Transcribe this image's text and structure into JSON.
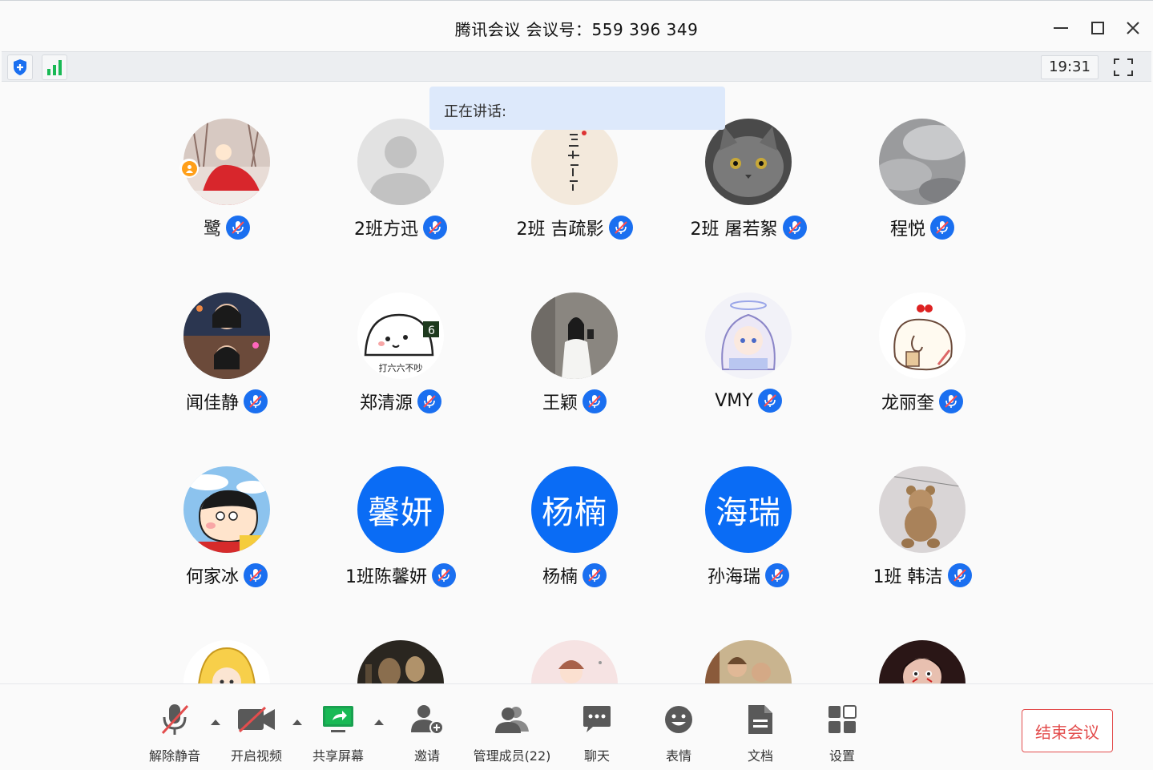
{
  "window": {
    "title": "腾讯会议 会议号：559 396 349"
  },
  "infobar": {
    "clock": "19:31",
    "icons": [
      "shield-icon",
      "signal-icon",
      "fullscreen-icon"
    ]
  },
  "speaking": {
    "label": "正在讲话:"
  },
  "participants": [
    {
      "name": "鹭",
      "avatar": "photo-girl-red-dress",
      "host": true
    },
    {
      "name": "2班方迅",
      "avatar": "default-silhouette"
    },
    {
      "name": "2班 吉疏影",
      "avatar": "photo-calligraphy"
    },
    {
      "name": "2班 屠若絮",
      "avatar": "photo-gray-cat"
    },
    {
      "name": "程悦",
      "avatar": "photo-cloudy-sky"
    },
    {
      "name": "闻佳静",
      "avatar": "photo-girl-portrait"
    },
    {
      "name": "郑清源",
      "avatar": "cartoon-face",
      "avatar_caption": "打六六不吵"
    },
    {
      "name": "王颖",
      "avatar": "photo-mirror-selfie"
    },
    {
      "name": "VMY",
      "avatar": "anime-character"
    },
    {
      "name": "龙丽奎",
      "avatar": "cartoon-bubble-tea"
    },
    {
      "name": "何家冰",
      "avatar": "cartoon-shin-chan"
    },
    {
      "name": "1班陈馨妍",
      "avatar": "text",
      "avatar_text": "馨妍"
    },
    {
      "name": "杨楠",
      "avatar": "text",
      "avatar_text": "杨楠"
    },
    {
      "name": "孙海瑞",
      "avatar": "text",
      "avatar_text": "海瑞"
    },
    {
      "name": "1班 韩洁",
      "avatar": "photo-teddy-bear"
    },
    {
      "name": "",
      "avatar": "cartoon-yellow-hood"
    },
    {
      "name": "",
      "avatar": "photo-dark-painting"
    },
    {
      "name": "",
      "avatar": "cartoon-pink-boy"
    },
    {
      "name": "",
      "avatar": "photo-painting-figures"
    },
    {
      "name": "",
      "avatar": "cartoon-dark-face"
    }
  ],
  "toolbar": {
    "unmute": "解除静音",
    "start_video": "开启视频",
    "share_screen": "共享屏幕",
    "invite": "邀请",
    "manage_members": "管理成员(22)",
    "chat": "聊天",
    "emoji": "表情",
    "docs": "文档",
    "settings": "设置",
    "end_meeting": "结束会议"
  },
  "colors": {
    "accent_blue": "#0a6cf5",
    "mic_blue": "#1a6ff0",
    "end_red": "#e34d4d",
    "signal_green": "#19b955"
  }
}
